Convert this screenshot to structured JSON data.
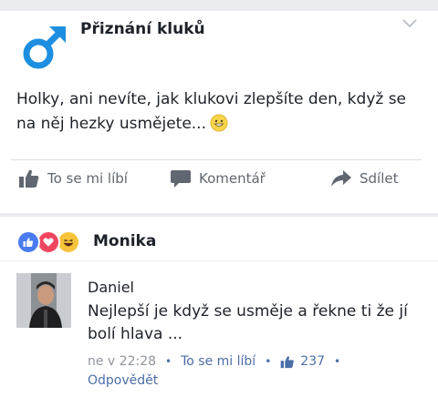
{
  "post": {
    "page_name": "Přiznání kluků",
    "text": "Holky, ani nevíte, jak klukovi zlepšíte den, když se na něj hezky usmějete...",
    "emoji": "grinning-emoji"
  },
  "actions": {
    "like": "To se mi líbí",
    "comment": "Komentář",
    "share": "Sdílet"
  },
  "reactions": {
    "icons": [
      "like-reaction",
      "love-reaction",
      "haha-reaction"
    ],
    "name": "Monika"
  },
  "comment": {
    "author": "Daniel",
    "text": "Nejlepší je když se usměje a řekne ti že jí bolí hlava ...",
    "time": "ne v 22:28",
    "like_label": "To se mi líbí",
    "like_count": "237",
    "reply_label": "Odpovědět"
  },
  "colors": {
    "link_blue": "#4b6ea8",
    "male_symbol": "#1d8fe0",
    "background": "#e9ebee"
  }
}
